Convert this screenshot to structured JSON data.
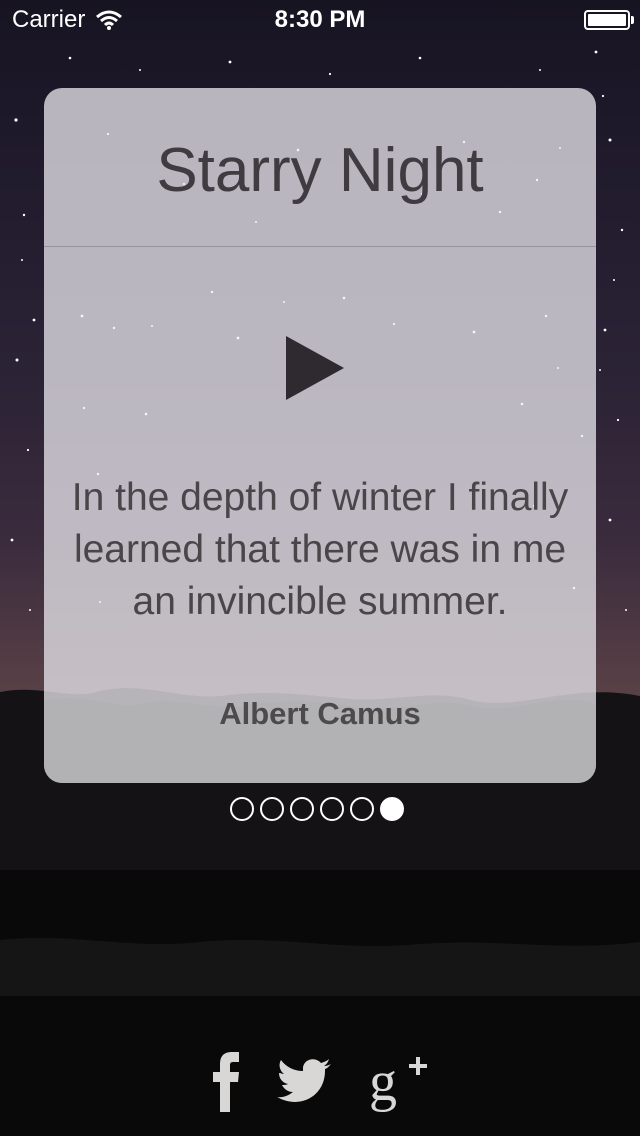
{
  "status_bar": {
    "carrier": "Carrier",
    "time": "8:30 PM"
  },
  "card": {
    "title": "Starry Night",
    "quote": "In the depth of winter I finally learned that there was in me an invincible summer.",
    "author": "Albert Camus"
  },
  "pager": {
    "count": 6,
    "active_index": 5
  },
  "social": [
    {
      "name": "facebook-icon"
    },
    {
      "name": "twitter-icon"
    },
    {
      "name": "google-plus-icon"
    }
  ],
  "colors": {
    "text": "#4a4549",
    "card_bg": "#e4e2e8",
    "icon": "#d9d6d6"
  }
}
